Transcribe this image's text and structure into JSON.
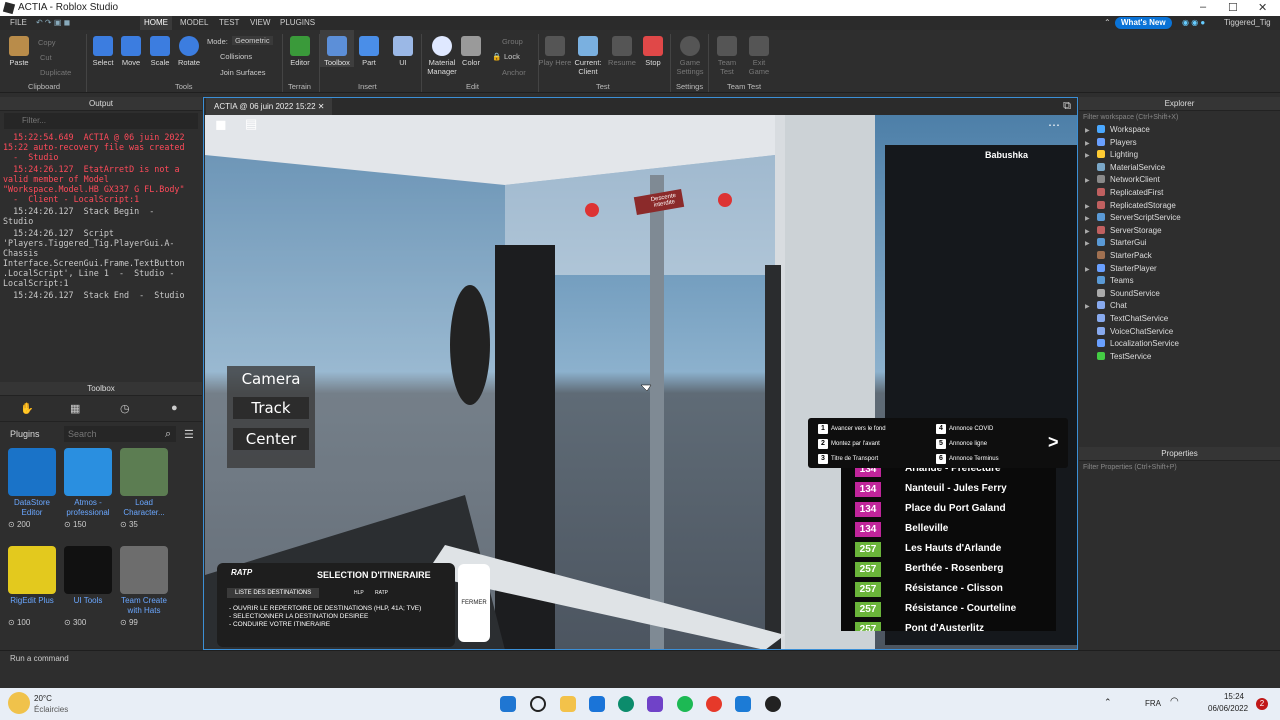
{
  "window": {
    "title": "ACTIA - Roblox Studio",
    "whats_new": "What's New",
    "user": "Tiggered_Tig"
  },
  "menu": [
    "FILE",
    "HOME",
    "MODEL",
    "TEST",
    "VIEW",
    "PLUGINS"
  ],
  "ribbon": {
    "clipboard": {
      "paste": "Paste",
      "copy": "Copy",
      "cut": "Cut",
      "duplicate": "Duplicate",
      "group": "Clipboard"
    },
    "tools": {
      "select": "Select",
      "move": "Move",
      "scale": "Scale",
      "rotate": "Rotate",
      "mode_label": "Mode:",
      "mode_value": "Geometric",
      "collisions": "Collisions",
      "join": "Join Surfaces",
      "group": "Tools"
    },
    "terrain": {
      "editor": "Editor",
      "group": "Terrain"
    },
    "insert": {
      "toolbox": "Toolbox",
      "part": "Part",
      "ui": "UI",
      "group": "Insert"
    },
    "edit": {
      "material": "Material Manager",
      "color": "Color",
      "group_btn": "Group",
      "lock": "Lock",
      "anchor": "Anchor",
      "group": "Edit"
    },
    "test": {
      "play": "Play Here",
      "current": "Current: Client",
      "resume": "Resume",
      "stop": "Stop",
      "group": "Test"
    },
    "settings": {
      "game": "Game Settings",
      "group": "Settings"
    },
    "team": {
      "team_test": "Team Test",
      "exit": "Exit Game",
      "group": "Team Test"
    }
  },
  "output": {
    "title": "Output",
    "filter_placeholder": "Filter...",
    "lines": [
      {
        "text": "  15:22:54.649  ACTIA @ 06 juin 2022\n15:22 auto-recovery file was created\n  -  Studio",
        "color": "red"
      },
      {
        "text": "  15:24:26.127  EtatArretD is not a\nvalid member of Model\n\"Workspace.Model.HB GX337 G FL.Body\"\n  -  Client - LocalScript:1",
        "color": "red"
      },
      {
        "text": "  15:24:26.127  Stack Begin  -\nStudio",
        "color": "grey"
      },
      {
        "text": "  15:24:26.127  Script\n'Players.Tiggered_Tig.PlayerGui.A-\nChassis\nInterface.ScreenGui.Frame.TextButton\n.LocalScript', Line 1  -  Studio -\nLocalScript:1",
        "color": "grey"
      },
      {
        "text": "  15:24:26.127  Stack End  -  Studio",
        "color": "grey"
      }
    ]
  },
  "toolbox": {
    "title": "Toolbox",
    "category": "Plugins",
    "search_placeholder": "Search",
    "items": [
      {
        "name": "DataStore Editor",
        "count": "200",
        "color": "#1a73c8"
      },
      {
        "name": "Atmos - professional",
        "count": "150",
        "color": "#2a8fe0"
      },
      {
        "name": "Load Character...",
        "count": "35",
        "color": "#5c7d52"
      },
      {
        "name": "RigEdit Plus",
        "count": "100",
        "color": "#e3c91e"
      },
      {
        "name": "UI Tools",
        "count": "300",
        "color": "#111111"
      },
      {
        "name": "Team Create with Hats",
        "count": "99",
        "color": "#6d6d6d"
      }
    ]
  },
  "viewport": {
    "tab": "ACTIA @ 06 juin 2022 15:22",
    "player": "Babushka",
    "camera": {
      "title": "Camera",
      "track": "Track",
      "center": "Center"
    },
    "sign": "Descente interdite",
    "annonces": [
      {
        "n": "1",
        "t": "Avancer vers le fond"
      },
      {
        "n": "2",
        "t": "Montez par l'avant"
      },
      {
        "n": "3",
        "t": "Titre de Transport"
      },
      {
        "n": "4",
        "t": "Annonce COVID"
      },
      {
        "n": "5",
        "t": "Annonce ligne"
      },
      {
        "n": "6",
        "t": "Annonce Terminus"
      }
    ],
    "arrow": ">",
    "destinations": [
      {
        "line": "134",
        "name": "Arlande - Préfecture"
      },
      {
        "line": "134",
        "name": "Nanteuil - Jules Ferry"
      },
      {
        "line": "134",
        "name": "Place du Port Galand"
      },
      {
        "line": "134",
        "name": "Belleville"
      },
      {
        "line": "257",
        "name": "Les Hauts d'Arlande"
      },
      {
        "line": "257",
        "name": "Berthée - Rosenberg"
      },
      {
        "line": "257",
        "name": "Résistance - Clisson"
      },
      {
        "line": "257",
        "name": "Résistance - Courteline"
      },
      {
        "line": "257",
        "name": "Pont d'Austerlitz"
      }
    ],
    "ratp": {
      "logo": "RATP",
      "title": "SELECTION D'ITINERAIRE",
      "list": "LISTE DES DESTINATIONS",
      "tag1": "HLP",
      "tag2": "RATP",
      "instructions": [
        "- OUVRIR LE REPERTOIRE DE DESTINATIONS (HLP, 41A; TVE)",
        "- SELECTIONNER LA DESTINATION DESIREE",
        "- CONDUIRE VOTRE ITINERAIRE"
      ],
      "close": "FERMER"
    }
  },
  "explorer": {
    "title": "Explorer",
    "filter": "Filter workspace (Ctrl+Shift+X)",
    "items": [
      {
        "name": "Workspace",
        "color": "#4aa8ff",
        "arrow": true
      },
      {
        "name": "Players",
        "color": "#6aa0ff",
        "arrow": true
      },
      {
        "name": "Lighting",
        "color": "#ffcc33",
        "arrow": true
      },
      {
        "name": "MaterialService",
        "color": "#7aa7c7",
        "arrow": false
      },
      {
        "name": "NetworkClient",
        "color": "#8a8a8a",
        "arrow": true
      },
      {
        "name": "ReplicatedFirst",
        "color": "#c06060",
        "arrow": false
      },
      {
        "name": "ReplicatedStorage",
        "color": "#c06060",
        "arrow": true
      },
      {
        "name": "ServerScriptService",
        "color": "#5a9ad6",
        "arrow": true
      },
      {
        "name": "ServerStorage",
        "color": "#c06060",
        "arrow": true
      },
      {
        "name": "StarterGui",
        "color": "#5a9ad6",
        "arrow": true
      },
      {
        "name": "StarterPack",
        "color": "#a07050",
        "arrow": false
      },
      {
        "name": "StarterPlayer",
        "color": "#6aa0ff",
        "arrow": true
      },
      {
        "name": "Teams",
        "color": "#5a9ad6",
        "arrow": false
      },
      {
        "name": "SoundService",
        "color": "#aaaaaa",
        "arrow": false
      },
      {
        "name": "Chat",
        "color": "#88aaee",
        "arrow": true
      },
      {
        "name": "TextChatService",
        "color": "#88aaee",
        "arrow": false
      },
      {
        "name": "VoiceChatService",
        "color": "#88aaee",
        "arrow": false
      },
      {
        "name": "LocalizationService",
        "color": "#6aa0ff",
        "arrow": false
      },
      {
        "name": "TestService",
        "color": "#44cc44",
        "arrow": false
      }
    ]
  },
  "properties": {
    "title": "Properties",
    "filter": "Filter Properties (Ctrl+Shift+P)"
  },
  "command": {
    "placeholder": "Run a command"
  },
  "taskbar": {
    "temp": "20°C",
    "weather": "Éclaircies",
    "lang": "FRA",
    "time": "15:24",
    "date": "06/06/2022",
    "notif": "2"
  }
}
